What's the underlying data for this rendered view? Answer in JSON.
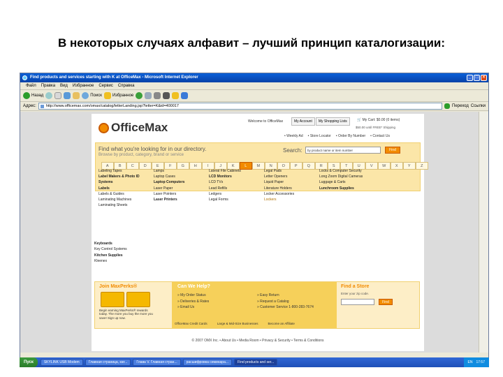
{
  "slide_title": "В некоторых случаях алфавит – лучший принцип каталогизации:",
  "window": {
    "title": "Find products and services starting with K at OfficeMax - Microsoft Internet Explorer"
  },
  "menu": [
    "Файл",
    "Правка",
    "Вид",
    "Избранное",
    "Сервис",
    "Справка"
  ],
  "toolbar": {
    "back": "Назад",
    "search": "Поиск",
    "favorites": "Избранное"
  },
  "addressbar": {
    "label": "Адрес:",
    "url": "http://www.officemax.com/omax/catalog/letterLanding.jsp?letter=K&id=400017",
    "go": "Переход",
    "links": "Ссылки"
  },
  "site": {
    "logo": "OfficeMax",
    "welcome": "Welcome to OfficeMax",
    "tabs": [
      "My Account",
      "My Shopping Lists"
    ],
    "cart": "My Cart: $0.00 (0 items)",
    "free_shipping": "$50.00 until FREE* Shipping",
    "navlinks": [
      "Weekly Ad",
      "Store Locator",
      "Order By Number",
      "Contact Us"
    ],
    "find_head": "Find what you're looking for in our directory.",
    "find_sub": "Browse by product, category, brand or service",
    "search_label": "Search:",
    "search_placeholder": "by product name or item number",
    "find_button": "Find",
    "letters": [
      "A",
      "B",
      "C",
      "D",
      "E",
      "F",
      "G",
      "H",
      "I",
      "J",
      "K",
      "L",
      "M",
      "N",
      "O",
      "P",
      "Q",
      "R",
      "S",
      "T",
      "U",
      "V",
      "W",
      "X",
      "Y",
      "Z"
    ],
    "active_letter": "L",
    "columns": [
      [
        "Labeling Tapes",
        "Label Makers & Photo ID Systems",
        "Labels",
        "Labels & Guides",
        "Laminating Machines",
        "Laminating Sheets"
      ],
      [
        "Lamps",
        "Laptop Cases",
        "Laptop Computers",
        "Laser Paper",
        "Laser Pointers",
        "Laser Printers"
      ],
      [
        "Lateral File Cabinets",
        "LCD Monitors",
        "LCD TVs",
        "Lead Refills",
        "Ledgers",
        "Legal Forms"
      ],
      [
        "Legal Pads",
        "Letter Openers",
        "Liquid Paper",
        "Literature Holders",
        "Locker Accessories",
        "Lockers"
      ],
      [
        "Locks & Computer Security",
        "Long Zoom Digital Cameras",
        "Luggage & Carts",
        "Lunchroom Supplies"
      ]
    ],
    "k_list": [
      "Keyboards",
      "Key Control Systems",
      "Kitchen Supplies",
      "Kleenex"
    ],
    "maxperks_head": "Join MaxPerks®",
    "maxperks_text": "Begin earning MaxPerks® rewards today. The more you buy the more you save! Sign up now.",
    "help_head": "Can We Help?",
    "help_left": [
      "My Order Status",
      "Deliveries & Rates",
      "Email Us"
    ],
    "help_right": [
      "Easy Return",
      "Request a Catalog",
      "Customer Service 1-800-283-7674"
    ],
    "help_bottom": [
      "OfficeMax Credit Cards",
      "Large & Mid-Size Businesses",
      "Become an Affiliate"
    ],
    "store_head": "Find a Store",
    "store_sub": "Enter your zip code.",
    "store_button": "Find",
    "footer": "© 2007 OMX Inc.   •  About Us   •  Media Room   •  Privacy & Security   •  Terms & Conditions"
  },
  "taskbar": {
    "start": "Пуск",
    "tasks": [
      "SKYLINK USB Modem",
      "Главная страница, кат...",
      "Глава V. Главная стран...",
      "расшифровка семинара...",
      "Find products and ser..."
    ],
    "lang": "EN",
    "clock": "17:57"
  }
}
